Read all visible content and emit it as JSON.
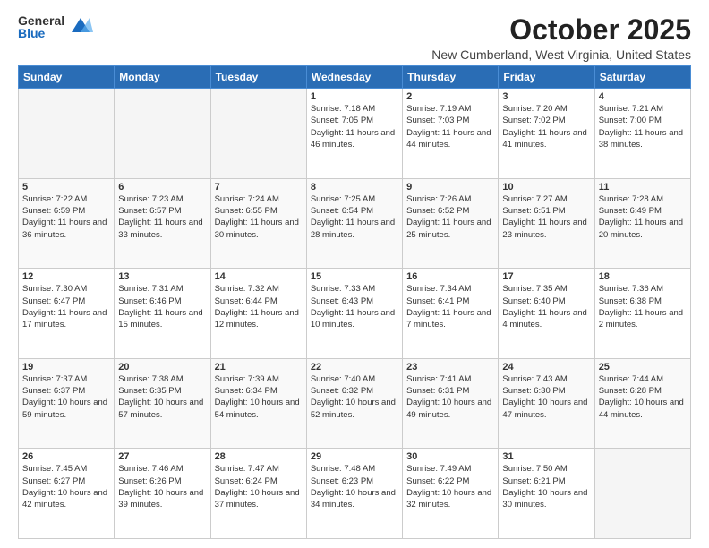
{
  "logo": {
    "general": "General",
    "blue": "Blue"
  },
  "header": {
    "title": "October 2025",
    "subtitle": "New Cumberland, West Virginia, United States"
  },
  "days_of_week": [
    "Sunday",
    "Monday",
    "Tuesday",
    "Wednesday",
    "Thursday",
    "Friday",
    "Saturday"
  ],
  "weeks": [
    [
      {
        "day": "",
        "info": ""
      },
      {
        "day": "",
        "info": ""
      },
      {
        "day": "",
        "info": ""
      },
      {
        "day": "1",
        "info": "Sunrise: 7:18 AM\nSunset: 7:05 PM\nDaylight: 11 hours and 46 minutes."
      },
      {
        "day": "2",
        "info": "Sunrise: 7:19 AM\nSunset: 7:03 PM\nDaylight: 11 hours and 44 minutes."
      },
      {
        "day": "3",
        "info": "Sunrise: 7:20 AM\nSunset: 7:02 PM\nDaylight: 11 hours and 41 minutes."
      },
      {
        "day": "4",
        "info": "Sunrise: 7:21 AM\nSunset: 7:00 PM\nDaylight: 11 hours and 38 minutes."
      }
    ],
    [
      {
        "day": "5",
        "info": "Sunrise: 7:22 AM\nSunset: 6:59 PM\nDaylight: 11 hours and 36 minutes."
      },
      {
        "day": "6",
        "info": "Sunrise: 7:23 AM\nSunset: 6:57 PM\nDaylight: 11 hours and 33 minutes."
      },
      {
        "day": "7",
        "info": "Sunrise: 7:24 AM\nSunset: 6:55 PM\nDaylight: 11 hours and 30 minutes."
      },
      {
        "day": "8",
        "info": "Sunrise: 7:25 AM\nSunset: 6:54 PM\nDaylight: 11 hours and 28 minutes."
      },
      {
        "day": "9",
        "info": "Sunrise: 7:26 AM\nSunset: 6:52 PM\nDaylight: 11 hours and 25 minutes."
      },
      {
        "day": "10",
        "info": "Sunrise: 7:27 AM\nSunset: 6:51 PM\nDaylight: 11 hours and 23 minutes."
      },
      {
        "day": "11",
        "info": "Sunrise: 7:28 AM\nSunset: 6:49 PM\nDaylight: 11 hours and 20 minutes."
      }
    ],
    [
      {
        "day": "12",
        "info": "Sunrise: 7:30 AM\nSunset: 6:47 PM\nDaylight: 11 hours and 17 minutes."
      },
      {
        "day": "13",
        "info": "Sunrise: 7:31 AM\nSunset: 6:46 PM\nDaylight: 11 hours and 15 minutes."
      },
      {
        "day": "14",
        "info": "Sunrise: 7:32 AM\nSunset: 6:44 PM\nDaylight: 11 hours and 12 minutes."
      },
      {
        "day": "15",
        "info": "Sunrise: 7:33 AM\nSunset: 6:43 PM\nDaylight: 11 hours and 10 minutes."
      },
      {
        "day": "16",
        "info": "Sunrise: 7:34 AM\nSunset: 6:41 PM\nDaylight: 11 hours and 7 minutes."
      },
      {
        "day": "17",
        "info": "Sunrise: 7:35 AM\nSunset: 6:40 PM\nDaylight: 11 hours and 4 minutes."
      },
      {
        "day": "18",
        "info": "Sunrise: 7:36 AM\nSunset: 6:38 PM\nDaylight: 11 hours and 2 minutes."
      }
    ],
    [
      {
        "day": "19",
        "info": "Sunrise: 7:37 AM\nSunset: 6:37 PM\nDaylight: 10 hours and 59 minutes."
      },
      {
        "day": "20",
        "info": "Sunrise: 7:38 AM\nSunset: 6:35 PM\nDaylight: 10 hours and 57 minutes."
      },
      {
        "day": "21",
        "info": "Sunrise: 7:39 AM\nSunset: 6:34 PM\nDaylight: 10 hours and 54 minutes."
      },
      {
        "day": "22",
        "info": "Sunrise: 7:40 AM\nSunset: 6:32 PM\nDaylight: 10 hours and 52 minutes."
      },
      {
        "day": "23",
        "info": "Sunrise: 7:41 AM\nSunset: 6:31 PM\nDaylight: 10 hours and 49 minutes."
      },
      {
        "day": "24",
        "info": "Sunrise: 7:43 AM\nSunset: 6:30 PM\nDaylight: 10 hours and 47 minutes."
      },
      {
        "day": "25",
        "info": "Sunrise: 7:44 AM\nSunset: 6:28 PM\nDaylight: 10 hours and 44 minutes."
      }
    ],
    [
      {
        "day": "26",
        "info": "Sunrise: 7:45 AM\nSunset: 6:27 PM\nDaylight: 10 hours and 42 minutes."
      },
      {
        "day": "27",
        "info": "Sunrise: 7:46 AM\nSunset: 6:26 PM\nDaylight: 10 hours and 39 minutes."
      },
      {
        "day": "28",
        "info": "Sunrise: 7:47 AM\nSunset: 6:24 PM\nDaylight: 10 hours and 37 minutes."
      },
      {
        "day": "29",
        "info": "Sunrise: 7:48 AM\nSunset: 6:23 PM\nDaylight: 10 hours and 34 minutes."
      },
      {
        "day": "30",
        "info": "Sunrise: 7:49 AM\nSunset: 6:22 PM\nDaylight: 10 hours and 32 minutes."
      },
      {
        "day": "31",
        "info": "Sunrise: 7:50 AM\nSunset: 6:21 PM\nDaylight: 10 hours and 30 minutes."
      },
      {
        "day": "",
        "info": ""
      }
    ]
  ]
}
